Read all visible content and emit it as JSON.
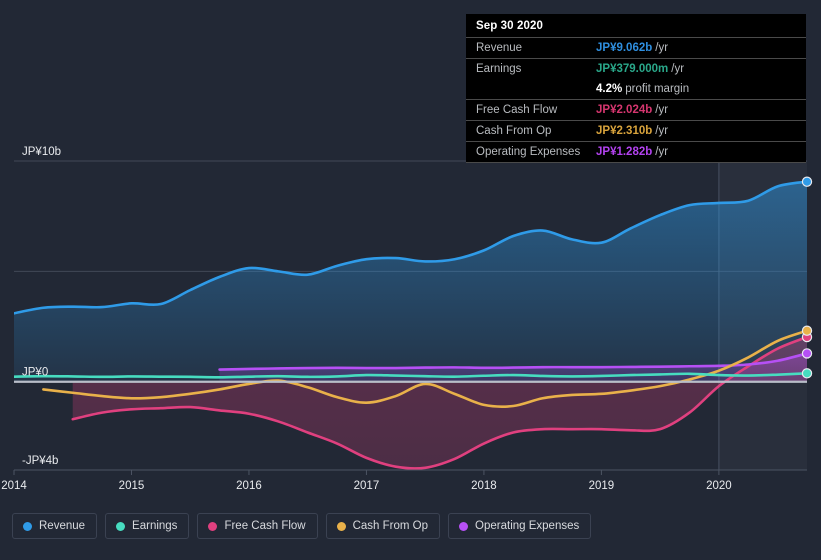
{
  "tooltip": {
    "date": "Sep 30 2020",
    "rows": [
      {
        "name": "Revenue",
        "value": "JP¥9.062b",
        "unit": "/yr",
        "color": "#2f8fe0"
      },
      {
        "name": "Earnings",
        "value": "JP¥379.000m",
        "unit": "/yr",
        "color": "#2aa88a"
      },
      {
        "name": "",
        "value": "4.2%",
        "unit": "profit margin",
        "color": "#ffffff",
        "sub": true
      },
      {
        "name": "Free Cash Flow",
        "value": "JP¥2.024b",
        "unit": "/yr",
        "color": "#d6366f"
      },
      {
        "name": "Cash From Op",
        "value": "JP¥2.310b",
        "unit": "/yr",
        "color": "#d8a33c"
      },
      {
        "name": "Operating Expenses",
        "value": "JP¥1.282b",
        "unit": "/yr",
        "color": "#b342f0"
      }
    ]
  },
  "legend": {
    "items": [
      {
        "label": "Revenue",
        "color": "#2f9be8"
      },
      {
        "label": "Earnings",
        "color": "#47dcc0"
      },
      {
        "label": "Free Cash Flow",
        "color": "#e0407f"
      },
      {
        "label": "Cash From Op",
        "color": "#e9b14a"
      },
      {
        "label": "Operating Expenses",
        "color": "#b650f5"
      }
    ]
  },
  "axes": {
    "y_ticks": [
      {
        "label": "JP¥10b",
        "value": 10
      },
      {
        "label": "JP¥0",
        "value": 0
      },
      {
        "label": "-JP¥4b",
        "value": -4
      }
    ],
    "y_gridlines": [
      10,
      5,
      0
    ],
    "x_ticks": [
      "2014",
      "2015",
      "2016",
      "2017",
      "2018",
      "2019",
      "2020"
    ]
  },
  "chart_data": {
    "type": "area",
    "title": "",
    "xlabel": "",
    "ylabel": "JP¥",
    "ylim": [
      -4,
      10
    ],
    "xlim": [
      2014.0,
      2020.75
    ],
    "grid": true,
    "legend_position": "bottom",
    "currency": "JP¥",
    "unit": "billions",
    "forecast_start": 2020.0,
    "x": [
      2014.0,
      2014.25,
      2014.5,
      2014.75,
      2015.0,
      2015.25,
      2015.5,
      2015.75,
      2016.0,
      2016.25,
      2016.5,
      2016.75,
      2017.0,
      2017.25,
      2017.5,
      2017.75,
      2018.0,
      2018.25,
      2018.5,
      2018.75,
      2019.0,
      2019.25,
      2019.5,
      2019.75,
      2020.0,
      2020.25,
      2020.5,
      2020.75
    ],
    "series": [
      {
        "name": "Revenue",
        "color": "#2f9be8",
        "values": [
          3.1,
          3.35,
          3.4,
          3.38,
          3.55,
          3.52,
          4.15,
          4.75,
          5.15,
          5.0,
          4.85,
          5.25,
          5.55,
          5.6,
          5.45,
          5.55,
          5.95,
          6.6,
          6.85,
          6.45,
          6.3,
          6.95,
          7.55,
          8.0,
          8.1,
          8.2,
          8.85,
          9.062
        ]
      },
      {
        "name": "Earnings",
        "color": "#47dcc0",
        "values": [
          0.23,
          0.25,
          0.24,
          0.22,
          0.24,
          0.23,
          0.22,
          0.2,
          0.23,
          0.25,
          0.22,
          0.24,
          0.3,
          0.28,
          0.25,
          0.23,
          0.27,
          0.3,
          0.26,
          0.24,
          0.26,
          0.3,
          0.33,
          0.36,
          0.3,
          0.28,
          0.32,
          0.379
        ]
      },
      {
        "name": "Free Cash Flow",
        "color": "#e0407f",
        "values": [
          null,
          null,
          -1.7,
          -1.4,
          -1.25,
          -1.2,
          -1.15,
          -1.3,
          -1.45,
          -1.8,
          -2.3,
          -2.8,
          -3.45,
          -3.85,
          -3.9,
          -3.5,
          -2.8,
          -2.3,
          -2.15,
          -2.15,
          -2.15,
          -2.2,
          -2.15,
          -1.4,
          -0.2,
          0.7,
          1.5,
          2.024
        ]
      },
      {
        "name": "Cash From Op",
        "color": "#e9b14a",
        "values": [
          null,
          -0.35,
          -0.5,
          -0.65,
          -0.75,
          -0.7,
          -0.55,
          -0.35,
          -0.1,
          0.05,
          -0.25,
          -0.7,
          -0.95,
          -0.65,
          -0.1,
          -0.55,
          -1.05,
          -1.1,
          -0.75,
          -0.6,
          -0.55,
          -0.4,
          -0.2,
          0.1,
          0.5,
          1.1,
          1.85,
          2.31
        ]
      },
      {
        "name": "Operating Expenses",
        "color": "#b650f5",
        "values": [
          null,
          null,
          null,
          null,
          null,
          null,
          null,
          0.55,
          0.58,
          0.6,
          0.62,
          0.63,
          0.62,
          0.62,
          0.64,
          0.65,
          0.63,
          0.64,
          0.66,
          0.66,
          0.66,
          0.67,
          0.68,
          0.7,
          0.72,
          0.78,
          0.95,
          1.282
        ]
      }
    ]
  }
}
